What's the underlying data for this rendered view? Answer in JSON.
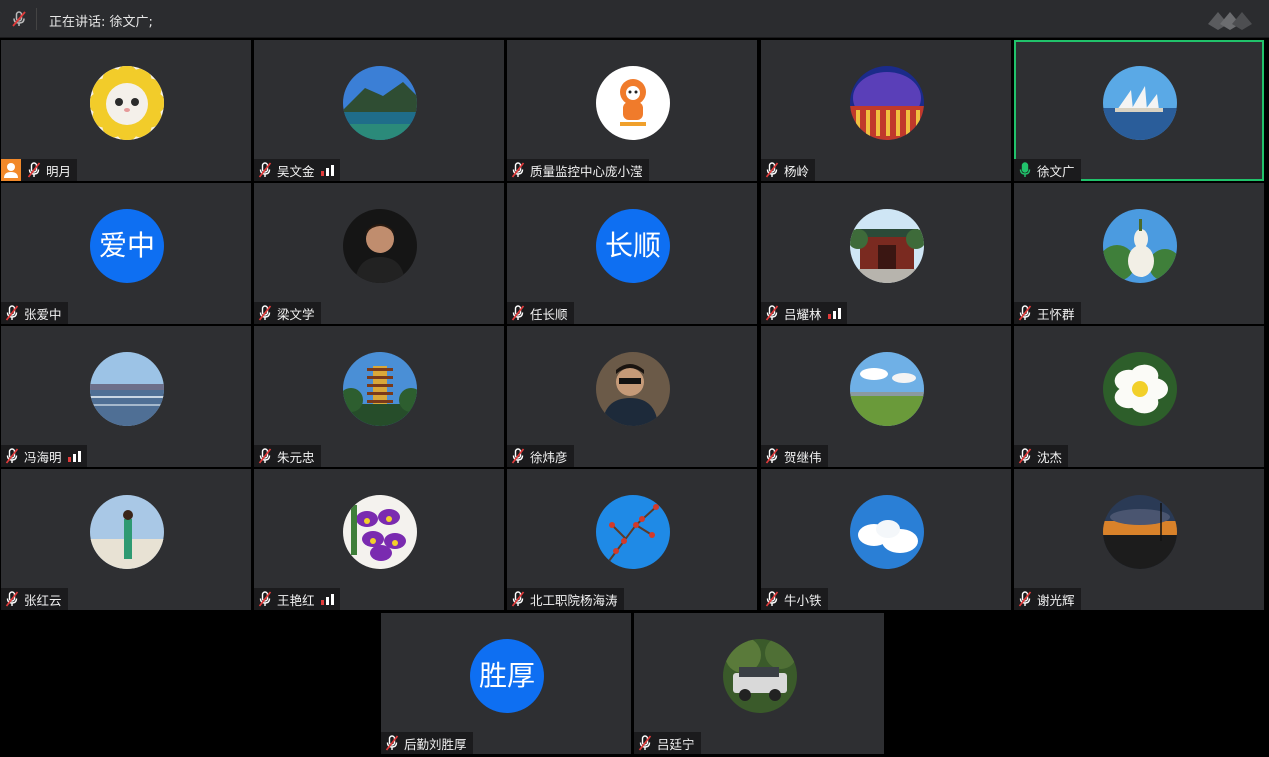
{
  "header": {
    "speaking_text": "正在讲话: 徐文广;",
    "mic_icon": "muted-mic-icon",
    "logo_icon": "app-logo-icon"
  },
  "colors": {
    "tile_bg": "#2e2f32",
    "active_border": "#21c26b",
    "initials_bg": "#0e6ff2",
    "host_badge": "#f2892a",
    "muted_mic": "#e03b3b",
    "active_mic": "#21c26b"
  },
  "participants": [
    {
      "name": "明月",
      "mic": "muted",
      "host": true,
      "avatar": "cat-flower"
    },
    {
      "name": "吴文金",
      "mic": "muted",
      "signal": true,
      "avatar": "mountain-lake"
    },
    {
      "name": "质量监控中心庞小滢",
      "mic": "muted",
      "avatar": "mascot"
    },
    {
      "name": "杨岭",
      "mic": "muted",
      "avatar": "stadium"
    },
    {
      "name": "徐文广",
      "mic": "active",
      "active": true,
      "avatar": "opera-house"
    },
    {
      "name": "张爱中",
      "mic": "muted",
      "initials": "爱中"
    },
    {
      "name": "梁文学",
      "mic": "muted",
      "avatar": "man-dark"
    },
    {
      "name": "任长顺",
      "mic": "muted",
      "initials": "长顺"
    },
    {
      "name": "吕耀林",
      "mic": "muted",
      "signal": true,
      "avatar": "temple-gate"
    },
    {
      "name": "王怀群",
      "mic": "muted",
      "avatar": "gourd"
    },
    {
      "name": "冯海明",
      "mic": "muted",
      "signal": true,
      "avatar": "lake-plain"
    },
    {
      "name": "朱元忠",
      "mic": "muted",
      "avatar": "pagoda"
    },
    {
      "name": "徐炜彦",
      "mic": "muted",
      "avatar": "man-sunglasses"
    },
    {
      "name": "贺继伟",
      "mic": "muted",
      "avatar": "grassland"
    },
    {
      "name": "沈杰",
      "mic": "muted",
      "avatar": "white-flower"
    },
    {
      "name": "张红云",
      "mic": "muted",
      "avatar": "woman-beach"
    },
    {
      "name": "王艳红",
      "mic": "muted",
      "signal": true,
      "avatar": "orchid"
    },
    {
      "name": "北工职院杨海涛",
      "mic": "muted",
      "avatar": "red-berries"
    },
    {
      "name": "牛小铁",
      "mic": "muted",
      "avatar": "clouds"
    },
    {
      "name": "谢光辉",
      "mic": "muted",
      "avatar": "sunset"
    },
    {
      "name": "后勤刘胜厚",
      "mic": "muted",
      "initials": "胜厚"
    },
    {
      "name": "吕廷宁",
      "mic": "muted",
      "avatar": "jeep"
    }
  ]
}
